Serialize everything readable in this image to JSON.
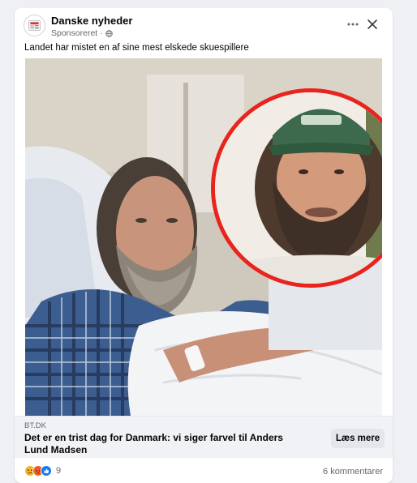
{
  "post": {
    "page_name": "Danske nyheder",
    "sponsored_label": "Sponsoreret",
    "separator": "·",
    "text": "Landet har mistet en af sine mest elskede skuespillere"
  },
  "link": {
    "domain": "BT.DK",
    "title": "Det er en trist dag for Danmark: vi siger farvel til Anders Lund Madsen",
    "cta_label": "Læs mere"
  },
  "footer": {
    "reaction_count": "9",
    "comments": "6 kommentarer"
  },
  "icons": {
    "more": "more-horizontal-icon",
    "close": "close-icon",
    "globe": "globe-icon",
    "reactions": [
      "sad-reaction-icon",
      "angry-reaction-icon",
      "like-reaction-icon"
    ]
  },
  "colors": {
    "accent_ring": "#e8241c",
    "like_blue": "#1877f2",
    "link_bar_bg": "#f0f2f5",
    "button_bg": "#e4e6eb"
  }
}
